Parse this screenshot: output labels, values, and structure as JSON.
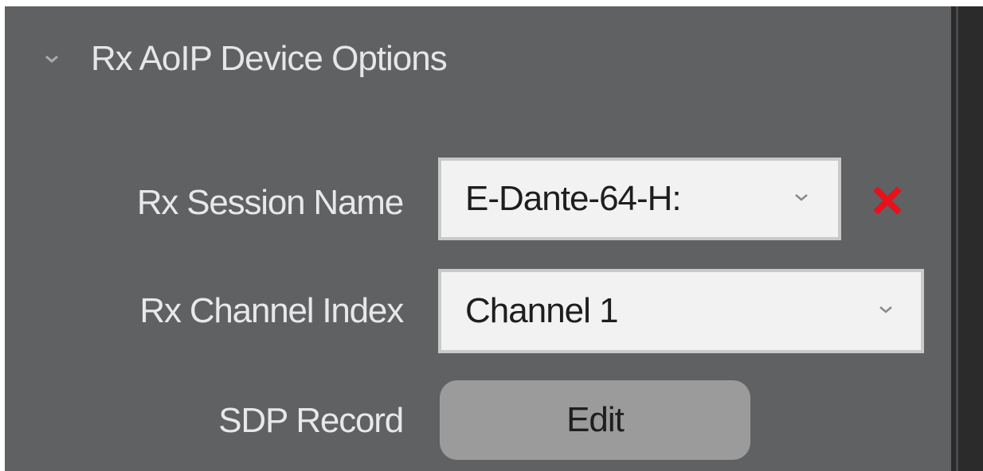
{
  "section": {
    "title": "Rx AoIP Device Options",
    "expanded": true
  },
  "fields": {
    "session_name": {
      "label": "Rx Session Name",
      "value": "E-Dante-64-H:"
    },
    "channel_index": {
      "label": "Rx Channel Index",
      "value": "Channel 1"
    },
    "sdp_record": {
      "label": "SDP Record",
      "button_label": "Edit"
    }
  },
  "icons": {
    "section_toggle": "chevron-down-icon",
    "dropdown": "chevron-down-icon",
    "clear": "close-icon"
  },
  "colors": {
    "panel_bg": "#5f6163",
    "label_text": "#e6e8ea",
    "field_bg": "#f2f2f2",
    "button_bg": "#9b9b9b",
    "clear_icon": "#e8101a"
  }
}
